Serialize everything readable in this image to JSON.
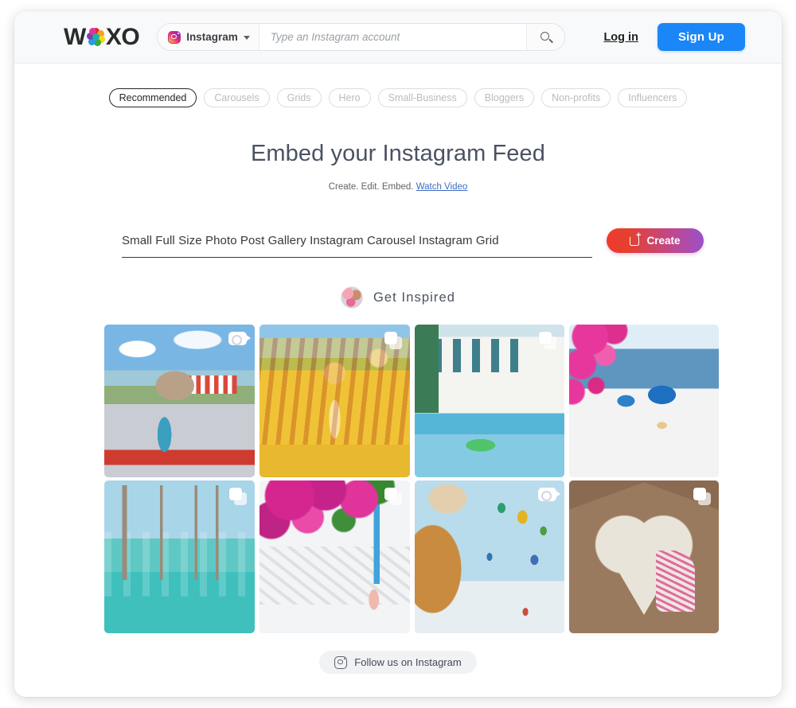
{
  "header": {
    "logo": {
      "left_text": "W",
      "right_text": "XO",
      "icon": "flower-dots-logo-icon",
      "dot_colors": [
        "#e12229",
        "#f5a31a",
        "#f2d91b",
        "#3aa83a",
        "#2b9ae0",
        "#7b3fb5",
        "#e0359b",
        "#19b3a8"
      ]
    },
    "search": {
      "platform_label": "Instagram",
      "platform_icon": "instagram-icon",
      "caret_icon": "chevron-down-icon",
      "placeholder": "Type an Instagram account",
      "value": "",
      "search_icon": "search-icon"
    },
    "login_label": "Log in",
    "signup_label": "Sign Up",
    "signup_color": "#1a86f7"
  },
  "chips": [
    {
      "label": "Recommended",
      "active": true
    },
    {
      "label": "Carousels",
      "active": false
    },
    {
      "label": "Grids",
      "active": false
    },
    {
      "label": "Hero",
      "active": false
    },
    {
      "label": "Small-Business",
      "active": false
    },
    {
      "label": "Bloggers",
      "active": false
    },
    {
      "label": "Non-profits",
      "active": false
    },
    {
      "label": "Influencers",
      "active": false
    }
  ],
  "hero": {
    "title": "Embed your Instagram Feed",
    "subtitle_text": "Create. Edit. Embed.",
    "subtitle_link": "Watch Video"
  },
  "create_row": {
    "tagline": "Small Full Size Photo Post Gallery Instagram Carousel Instagram Grid",
    "button_label": "Create",
    "button_icon": "create-plus-icon",
    "gradient_from": "#ee3b2e",
    "gradient_to": "#9a50c9"
  },
  "inspired": {
    "label": "Get Inspired",
    "avatar_icon": "profile-avatar"
  },
  "gallery": {
    "tiles": [
      {
        "id": "tile-1",
        "alt": "Woman in blue dress on street with Hagia Sophia and red-striped cart",
        "badge": "video",
        "art": "p1"
      },
      {
        "id": "tile-2",
        "alt": "Woman in white dress standing in yellow tulip field with windmill",
        "badge": "carousel",
        "art": "p2"
      },
      {
        "id": "tile-3",
        "alt": "White villa with teal shutters and pool with green crocodile float",
        "badge": "carousel",
        "art": "p3"
      },
      {
        "id": "tile-4",
        "alt": "Woman with straw hat overlooking Santorini blue domes and sea",
        "badge": "none",
        "art": "p4"
      },
      {
        "id": "tile-5",
        "alt": "Person on hammock over turquoise ocean between wooden posts",
        "badge": "carousel",
        "art": "p5"
      },
      {
        "id": "tile-6",
        "alt": "Woman walking in Mykonos alley under pink bougainvillea",
        "badge": "carousel",
        "art": "p6"
      },
      {
        "id": "tile-7",
        "alt": "Woman in fur hat watching hot air balloons over snowy Cappadocia",
        "badge": "video",
        "art": "p7"
      },
      {
        "id": "tile-8",
        "alt": "Woman framed by heart-shaped cave opening with hot air balloons",
        "badge": "carousel",
        "art": "p8"
      }
    ]
  },
  "follow": {
    "label": "Follow us on Instagram",
    "icon": "instagram-icon"
  }
}
